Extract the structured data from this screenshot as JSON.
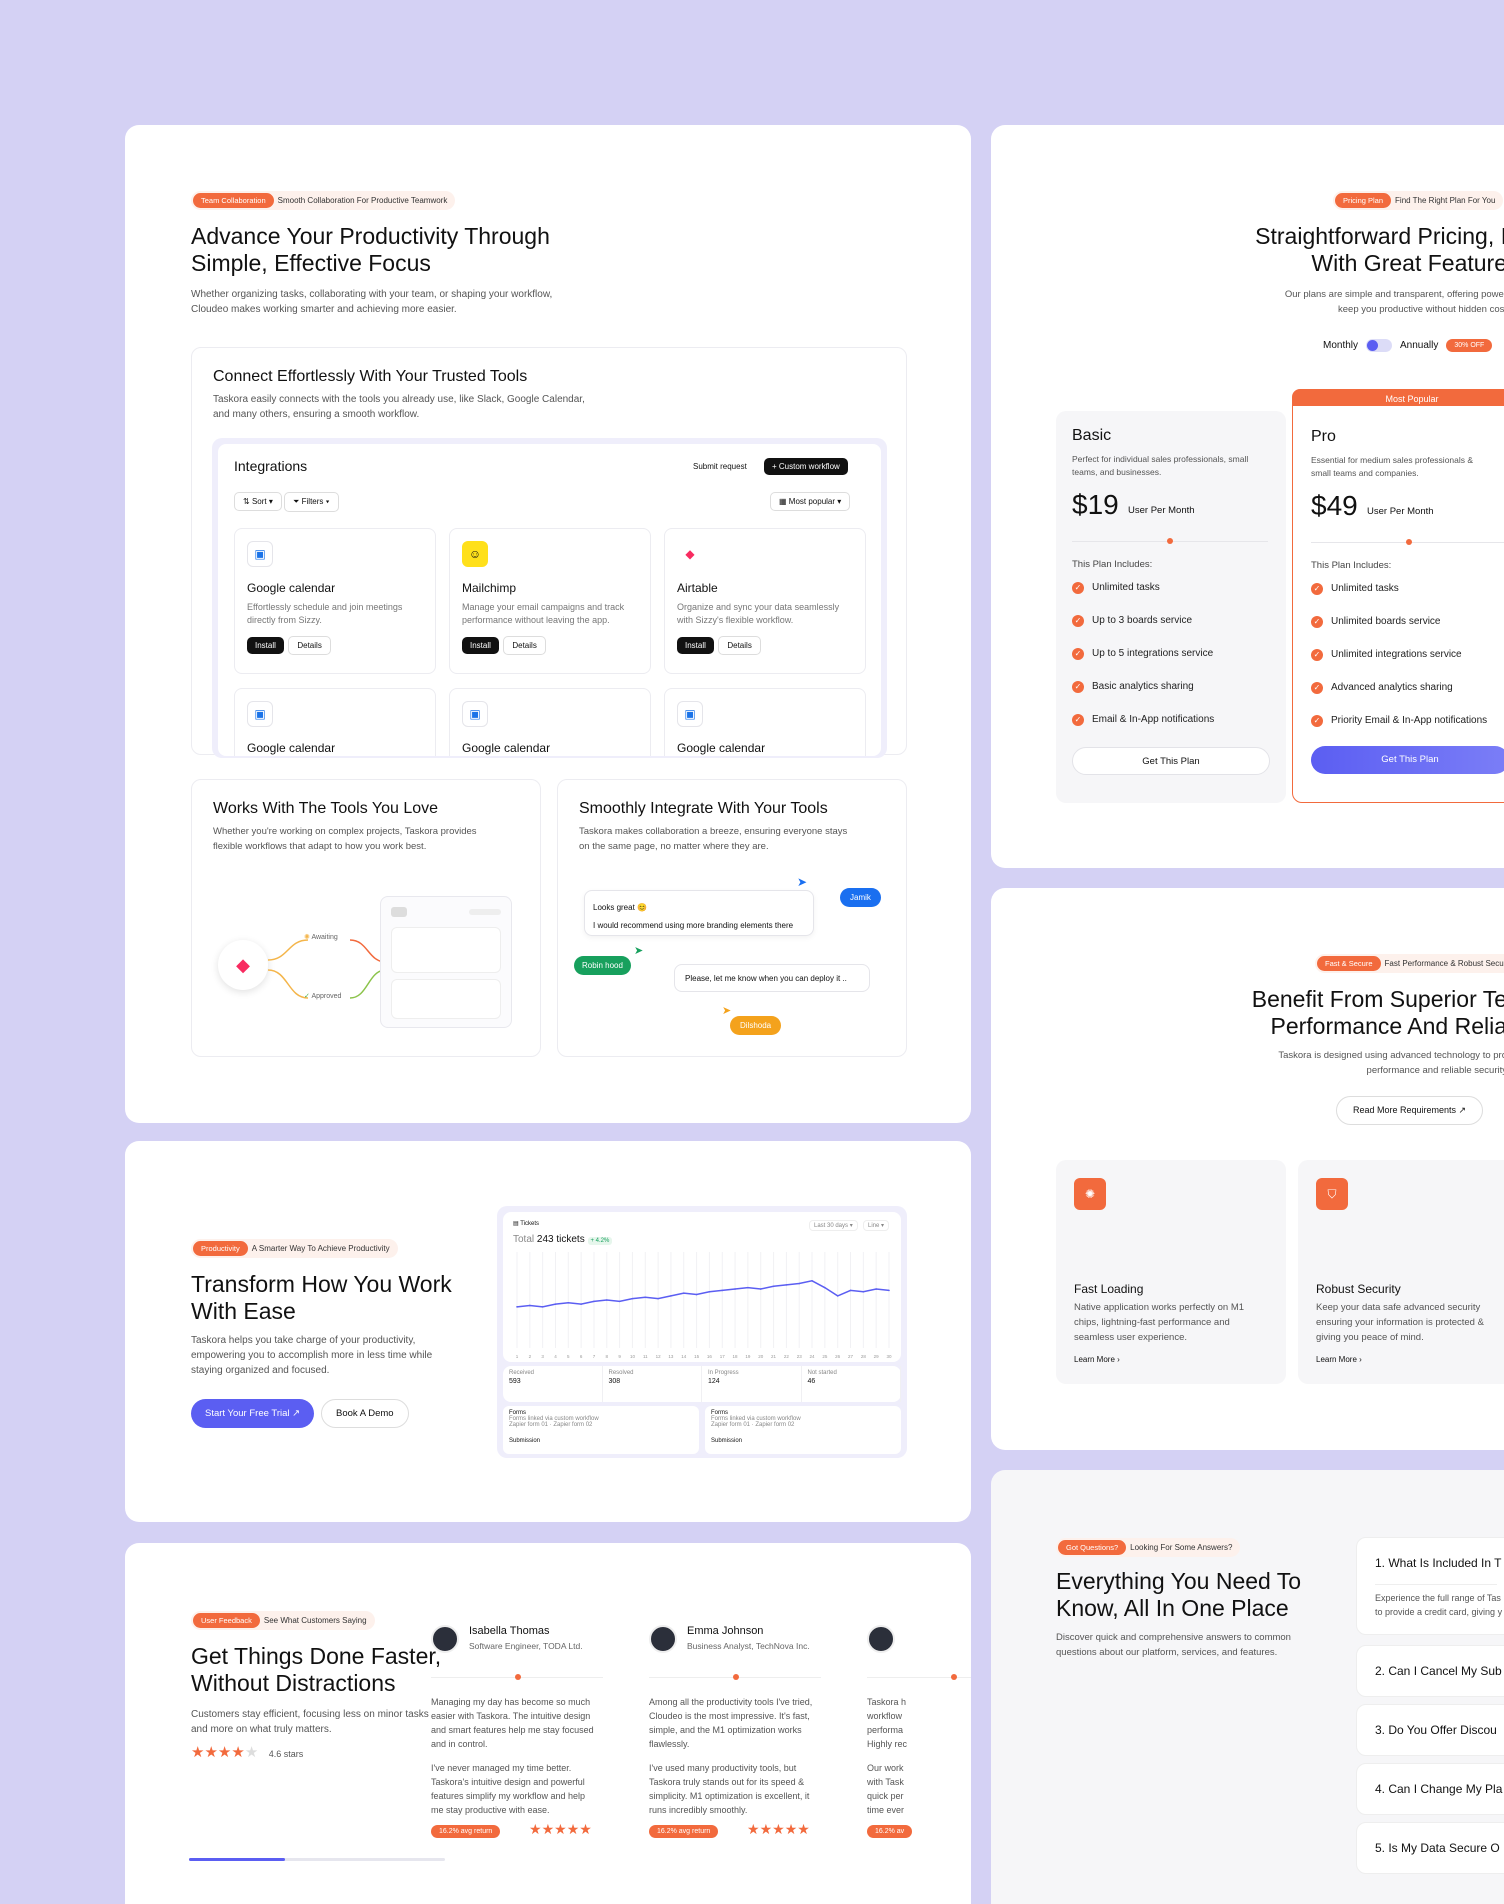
{
  "team": {
    "tag": "Team Collaboration",
    "tag_text": "Smooth Collaboration For Productive Teamwork",
    "title_1": "Advance Your Productivity Through",
    "title_2": "Simple, Effective Focus",
    "desc_1": "Whether organizing tasks, collaborating with your team, or shaping your workflow,",
    "desc_2": "Cloudeo makes working smarter and achieving more easier."
  },
  "connect": {
    "title": "Connect Effortlessly With Your Trusted Tools",
    "desc_1": "Taskora easily connects with the tools you already use, like Slack, Google Calendar,",
    "desc_2": "and many others, ensuring a smooth workflow."
  },
  "integrations": {
    "title": "Integrations",
    "submit": "Submit request",
    "custom": "+ Custom workflow",
    "sort": "Sort",
    "filters": "Filters",
    "most_popular": "Most popular",
    "install": "Install",
    "details": "Details",
    "items": [
      {
        "name": "Google calendar",
        "desc_1": "Effortlessly schedule and join meetings",
        "desc_2": "directly from Sizzy."
      },
      {
        "name": "Mailchimp",
        "desc_1": "Manage your email campaigns and track",
        "desc_2": "performance without leaving the app."
      },
      {
        "name": "Airtable",
        "desc_1": "Organize and sync your data seamlessly",
        "desc_2": "with Sizzy's flexible workflow."
      },
      {
        "name": "Google calendar"
      },
      {
        "name": "Google calendar"
      },
      {
        "name": "Google calendar"
      }
    ]
  },
  "tools": {
    "title": "Works With The Tools You Love",
    "desc_1": "Whether you're working on complex projects, Taskora provides",
    "desc_2": "flexible workflows that adapt to how you work best.",
    "awaiting": "Awaiting",
    "approved": "Approved"
  },
  "smooth": {
    "title": "Smoothly Integrate With Your Tools",
    "desc_1": "Taskora makes collaboration a breeze, ensuring everyone stays",
    "desc_2": "on the same page, no matter where they are.",
    "msg1": "Looks great 😊",
    "msg2": "I would recommend using more branding elements there",
    "msg3": "Please, let me know when you can deploy it ..",
    "jamik": "Jamik",
    "robin": "Robin hood",
    "dilshoda": "Dilshoda"
  },
  "transform": {
    "tag": "Productivity",
    "tag_text": "A Smarter Way To Achieve Productivity",
    "title_1": "Transform How You Work",
    "title_2": "With Ease",
    "desc_1": "Taskora helps you take charge of your productivity,",
    "desc_2": "empowering you to accomplish more in less time while",
    "desc_3": "staying organized and focused.",
    "cta": "Start Your Free Trial ↗",
    "demo": "Book A Demo"
  },
  "tickets": {
    "title": "Tickets",
    "total_label": "Total",
    "total": "243 tickets",
    "delta": "+ 4.2%",
    "range": "Last 30 days",
    "view": "Line",
    "stats": [
      {
        "label": "Received",
        "value": "593"
      },
      {
        "label": "Resolved",
        "value": "308"
      },
      {
        "label": "In Progress",
        "value": "124"
      },
      {
        "label": "Not started",
        "value": "46"
      }
    ],
    "forms": "Forms",
    "forms_desc": "Forms linked via custom workflow",
    "zapier1": "Zapier form 01",
    "zapier2": "Zapier form 02",
    "submission": "Submission",
    "x_ticks": [
      "1",
      "2",
      "3",
      "4",
      "5",
      "6",
      "7",
      "8",
      "9",
      "10",
      "11",
      "12",
      "13",
      "14",
      "15",
      "16",
      "17",
      "18",
      "19",
      "20",
      "21",
      "22",
      "23",
      "24",
      "25",
      "26",
      "27",
      "28",
      "29",
      "30"
    ]
  },
  "chart_data": {
    "type": "line",
    "x": [
      1,
      2,
      3,
      4,
      5,
      6,
      7,
      8,
      9,
      10,
      11,
      12,
      13,
      14,
      15,
      16,
      17,
      18,
      19,
      20,
      21,
      22,
      23,
      24,
      25,
      26,
      27,
      28,
      29,
      30
    ],
    "series": [
      {
        "values": [
          30,
          31,
          30,
          32,
          33,
          32,
          34,
          35,
          34,
          36,
          37,
          36,
          38,
          40,
          39,
          41,
          42,
          43,
          44,
          43,
          45,
          46,
          47,
          49,
          44,
          38,
          42,
          41,
          43,
          42
        ]
      }
    ],
    "ylim": [
      0,
      70
    ]
  },
  "feedback": {
    "tag": "User Feedback",
    "tag_text": "See What Customers Saying",
    "title_1": "Get Things Done Faster,",
    "title_2": "Without Distractions",
    "desc_1": "Customers stay efficient, focusing less on minor tasks",
    "desc_2": "and more on what truly matters.",
    "rating": "4.6 stars",
    "reviews": [
      {
        "name": "Isabella Thomas",
        "role": "Software Engineer, TODA Ltd.",
        "p1": [
          "Managing my day has become so much",
          "easier with Taskora. The intuitive design",
          "and smart features help me stay focused",
          "and in control."
        ],
        "p2": [
          "I've never managed my time better.",
          "Taskora's intuitive design and powerful",
          "features simplify my workflow and help",
          "me stay productive with ease."
        ],
        "badge": "16.2% avg return"
      },
      {
        "name": "Emma Johnson",
        "role": "Business Analyst, TechNova Inc.",
        "p1": [
          "Among all the productivity tools I've tried,",
          "Cloudeo is the most impressive. It's fast,",
          "simple, and the M1 optimization works",
          "flawlessly."
        ],
        "p2": [
          "I've used many productivity tools, but",
          "Taskora truly stands out for its speed &",
          "simplicity. M1 optimization is excellent, it",
          "runs incredibly smoothly."
        ],
        "badge": "16.2% avg return"
      },
      {
        "name": "",
        "role": "",
        "p1": [
          "Taskora h",
          "workflow",
          "performa",
          "Highly rec"
        ],
        "p2": [
          "Our work",
          "with Task",
          "quick per",
          "time ever"
        ],
        "badge": "16.2% av"
      }
    ]
  },
  "pricing": {
    "tag": "Pricing Plan",
    "tag_text": "Find The Right Plan For You",
    "title_1": "Straightforward Pricing, I",
    "title_2": "With Great Feature",
    "desc_1": "Our plans are simple and transparent, offering power",
    "desc_2": "keep you productive without hidden cost",
    "monthly": "Monthly",
    "annually": "Annually",
    "off": "30% OFF",
    "most_popular": "Most Popular",
    "includes": "This Plan Includes:",
    "per": "User Per Month",
    "plans": [
      {
        "name": "Basic",
        "desc_1": "Perfect for individual sales professionals, small",
        "desc_2": "teams, and businesses.",
        "price": "$19",
        "cta": "Get This Plan",
        "features": [
          "Unlimited tasks",
          "Up to 3 boards service",
          "Up to 5 integrations service",
          "Basic analytics sharing",
          "Email & In-App notifications"
        ]
      },
      {
        "name": "Pro",
        "desc_1": "Essential for medium sales professionals &",
        "desc_2": "small teams and companies.",
        "price": "$49",
        "cta": "Get This Plan",
        "features": [
          "Unlimited tasks",
          "Unlimited boards service",
          "Unlimited integrations service",
          "Advanced analytics sharing",
          "Priority Email & In-App notifications"
        ]
      }
    ]
  },
  "security": {
    "tag": "Fast & Secure",
    "tag_text": "Fast Performance & Robust Security",
    "title_1": "Benefit From Superior Te",
    "title_2": "Performance And Relia",
    "desc_1": "Taskora is designed using advanced technology to pro",
    "desc_2": "performance and reliable security",
    "read_more": "Read More Requirements ↗",
    "cards": [
      {
        "title": "Fast Loading",
        "lines": [
          "Native application works perfectly on M1",
          "chips, lightning-fast performance and",
          "seamless user experience."
        ],
        "link": "Learn More"
      },
      {
        "title": "Robust Security",
        "lines": [
          "Keep your data safe advanced security",
          "ensuring your information is protected &",
          "giving you peace of mind."
        ],
        "link": "Learn More"
      }
    ]
  },
  "faq": {
    "tag": "Got Questions?",
    "tag_text": "Looking For Some Answers?",
    "title_1": "Everything You Need To",
    "title_2": "Know, All In One Place",
    "desc_1": "Discover quick and comprehensive answers to common",
    "desc_2": "questions about our platform, services, and features.",
    "open_q": "1. What Is Included In T",
    "open_a_1": "Experience the full range of Tas",
    "open_a_2": "to provide a credit card, giving y",
    "items": [
      "2. Can I Cancel My Sub",
      "3. Do You Offer Discou",
      "4. Can I Change My Pla",
      "5. Is My Data Secure O"
    ]
  },
  "colors": {
    "accent": "#f26a3d",
    "primary": "#5b5ef2",
    "bg": "#d4d1f4"
  }
}
